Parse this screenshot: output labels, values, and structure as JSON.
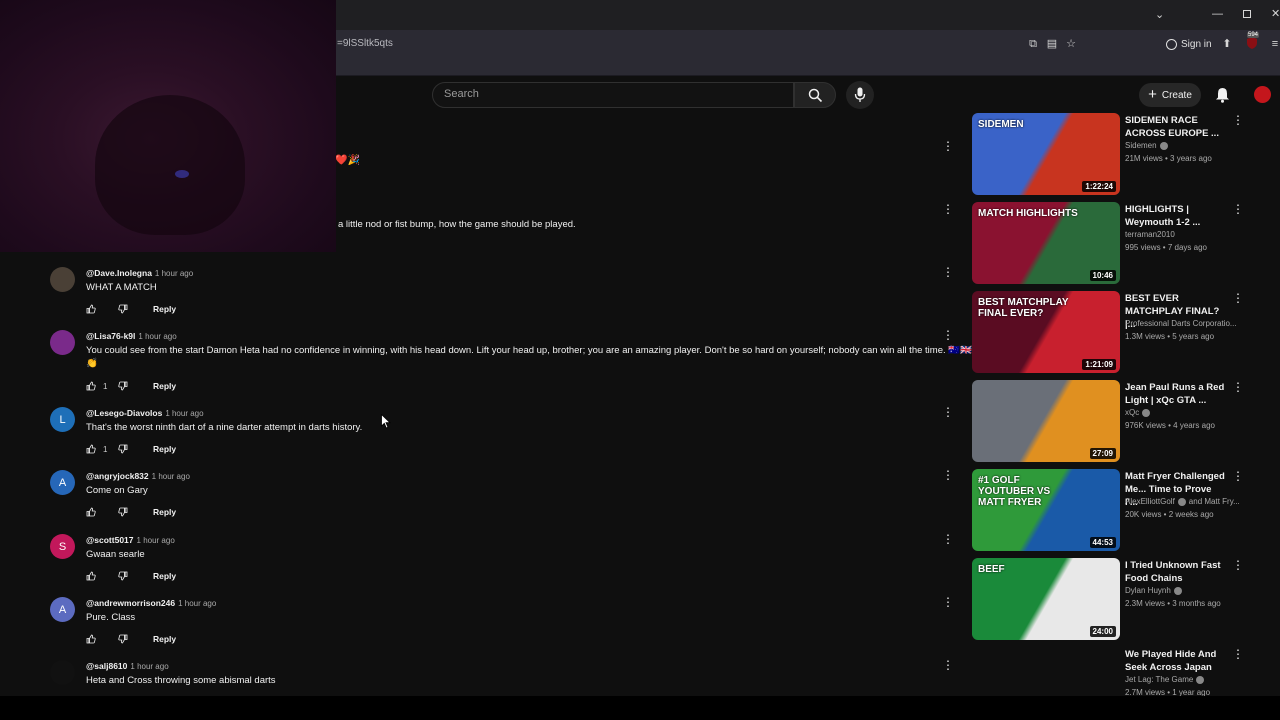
{
  "browser": {
    "url_fragment": "=9lSSltk5qts",
    "sign_in_label": "Sign in",
    "badge_count": "594"
  },
  "youtube": {
    "search_placeholder": "Search",
    "create_label": "Create"
  },
  "partial_comment": {
    "emoji_text": "❤️🎉",
    "text": "a little nod or fist bump, how the game should be played."
  },
  "comments": [
    {
      "author": "@Dave.Inolegna",
      "time": "1 hour ago",
      "text": "WHAT A MATCH",
      "likes": "",
      "reply": "Reply",
      "avatar_letter": "",
      "avatar_color": "#4a4036"
    },
    {
      "author": "@Lisa76-k9l",
      "time": "1 hour ago",
      "text": "You could see from the start Damon Heta had no confidence in winning, with his head down. Lift your head up, brother; you are an amazing player. Don't be so hard on yourself; nobody can win all the time. 🇦🇺🇬🇧",
      "text2": "👏",
      "likes": "1",
      "reply": "Reply",
      "avatar_letter": "",
      "avatar_color": "#7a2a8a"
    },
    {
      "author": "@Lesego-Diavolos",
      "time": "1 hour ago",
      "text": "That's the worst ninth dart of a nine darter attempt in darts history.",
      "likes": "1",
      "reply": "Reply",
      "avatar_letter": "L",
      "avatar_color": "#1e6fb8"
    },
    {
      "author": "@angryjock832",
      "time": "1 hour ago",
      "text": "Come on Gary",
      "likes": "",
      "reply": "Reply",
      "avatar_letter": "A",
      "avatar_color": "#2667b8"
    },
    {
      "author": "@scott5017",
      "time": "1 hour ago",
      "text": "Gwaan searle",
      "likes": "",
      "reply": "Reply",
      "avatar_letter": "S",
      "avatar_color": "#c2185b"
    },
    {
      "author": "@andrewmorrison246",
      "time": "1 hour ago",
      "text": "Pure. Class",
      "likes": "",
      "reply": "Reply",
      "avatar_letter": "A",
      "avatar_color": "#5c6bc0"
    },
    {
      "author": "@salj8610",
      "time": "1 hour ago",
      "text": "Heta and Cross throwing some abismal darts",
      "likes": "",
      "reply": "",
      "avatar_letter": "",
      "avatar_color": "#111111"
    }
  ],
  "sidebar_videos": [
    {
      "title": "SIDEMEN RACE ACROSS EUROPE ...",
      "channel": "Sidemen",
      "verified": true,
      "meta": "21M views • 3 years ago",
      "duration": "1:22:24",
      "thumb_colors": [
        "#3a63c8",
        "#c8341f"
      ],
      "thumb_text": "SIDEMEN"
    },
    {
      "title": "HIGHLIGHTS | Weymouth 1-2 ...",
      "channel": "terraman2010",
      "verified": false,
      "meta": "995 views • 7 days ago",
      "duration": "10:46",
      "thumb_colors": [
        "#8a1230",
        "#2a6a3a"
      ],
      "thumb_text": "MATCH HIGHLIGHTS"
    },
    {
      "title": "BEST EVER MATCHPLAY FINAL? |...",
      "channel": "Professional Darts Corporatio...",
      "verified": false,
      "meta": "1.3M views • 5 years ago",
      "duration": "1:21:09",
      "thumb_colors": [
        "#5a0c22",
        "#c8202e"
      ],
      "thumb_text": "BEST MATCHPLAY FINAL EVER?"
    },
    {
      "title": "Jean Paul Runs a Red Light | xQc GTA ...",
      "channel": "xQc",
      "verified": true,
      "meta": "976K views • 4 years ago",
      "duration": "27:09",
      "thumb_colors": [
        "#6a6f78",
        "#e09020"
      ],
      "thumb_text": ""
    },
    {
      "title": "Matt Fryer Challenged Me... Time to Prove I'...",
      "channel": "AlexElliottGolf",
      "channel_extra": "and Matt Fry...",
      "verified": true,
      "meta": "20K views • 2 weeks ago",
      "duration": "44:53",
      "thumb_colors": [
        "#2f9a3a",
        "#1a5aa8"
      ],
      "thumb_text": "#1 GOLF YOUTUBER VS MATT FRYER"
    },
    {
      "title": "I Tried Unknown Fast Food Chains",
      "channel": "Dylan Huynh",
      "verified": true,
      "meta": "2.3M views • 3 months ago",
      "duration": "24:00",
      "thumb_colors": [
        "#1a8a3a",
        "#e8e8e8"
      ],
      "thumb_text": "BEEF"
    },
    {
      "title": "We Played Hide And Seek Across Japan",
      "channel": "Jet Lag: The Game",
      "verified": true,
      "meta": "2.7M views • 1 year ago",
      "duration": "",
      "thumb_colors": [
        "#0f0f0f",
        "#0f0f0f"
      ],
      "thumb_text": ""
    }
  ]
}
